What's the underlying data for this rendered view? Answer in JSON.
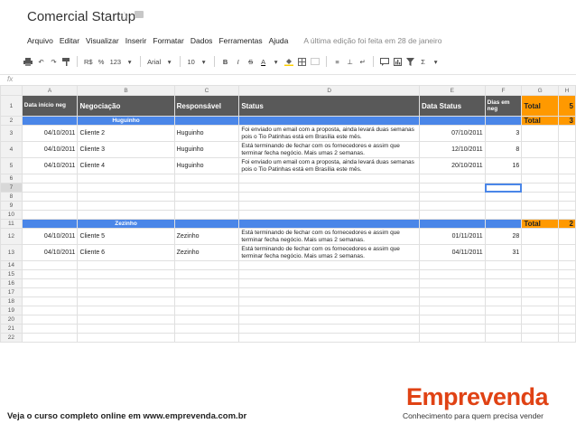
{
  "app": {
    "title": "Comercial Startup",
    "star_icon": "star-icon",
    "folder_icon": "folder-icon"
  },
  "menu": [
    "Arquivo",
    "Editar",
    "Visualizar",
    "Inserir",
    "Formatar",
    "Dados",
    "Ferramentas",
    "Ajuda"
  ],
  "last_edit": "A última edição foi feita em 28 de janeiro",
  "toolbar": {
    "currency": "R$",
    "percent": "%",
    "number_format": "123",
    "font": "Arial",
    "font_size": "10",
    "bold": "B",
    "italic": "I",
    "strike": "S",
    "text_color": "A",
    "sigma": "Σ"
  },
  "formula_bar": {
    "label": "fx"
  },
  "columns": [
    "A",
    "B",
    "C",
    "D",
    "E",
    "F",
    "G",
    "H"
  ],
  "header_row": {
    "a": "Data início neg",
    "b": "Negociação",
    "c": "Responsável",
    "d": "Status",
    "e": "Data Status",
    "f": "Dias em neg",
    "g": "Total",
    "h": "5"
  },
  "group1": {
    "name": "Huguinho",
    "total_label": "Total",
    "total": "3"
  },
  "group2": {
    "name": "Zezinho",
    "total_label": "Total",
    "total": "2"
  },
  "rows": [
    {
      "date": "04/10/2011",
      "client": "Cliente 2",
      "resp": "Huguinho",
      "status": "Foi enviado um email com a proposta, ainda levará duas semanas pois o Tio Patinhas está em Brasília este mês.",
      "status_date": "07/10/2011",
      "days": "3"
    },
    {
      "date": "04/10/2011",
      "client": "Cliente 3",
      "resp": "Huguinho",
      "status": "Está terminando de fechar com os fornecedores e assim que terminar fecha negócio. Mais umas 2 semanas.",
      "status_date": "12/10/2011",
      "days": "8"
    },
    {
      "date": "04/10/2011",
      "client": "Cliente 4",
      "resp": "Huguinho",
      "status": "Foi enviado um email com a proposta, ainda levará duas semanas pois o Tio Patinhas está em Brasília este mês.",
      "status_date": "20/10/2011",
      "days": "16"
    },
    {
      "date": "04/10/2011",
      "client": "Cliente 5",
      "resp": "Zezinho",
      "status": "Está terminando de fechar com os fornecedores e assim que terminar fecha negócio. Mais umas 2 semanas.",
      "status_date": "01/11/2011",
      "days": "28"
    },
    {
      "date": "04/10/2011",
      "client": "Cliente 6",
      "resp": "Zezinho",
      "status": "Está terminando de fechar com os fornecedores e assim que terminar fecha negócio. Mais umas 2 semanas.",
      "status_date": "04/11/2011",
      "days": "31"
    }
  ],
  "row_numbers": [
    "1",
    "2",
    "3",
    "4",
    "5",
    "6",
    "7",
    "8",
    "9",
    "10",
    "11",
    "12",
    "13",
    "14",
    "15",
    "16",
    "17",
    "18",
    "19",
    "20",
    "21",
    "22"
  ],
  "footer": {
    "course_text": "Veja o curso completo online em www.emprevenda.com.br",
    "brand": "Emprevenda",
    "tagline": "Conhecimento para quem precisa vender"
  }
}
